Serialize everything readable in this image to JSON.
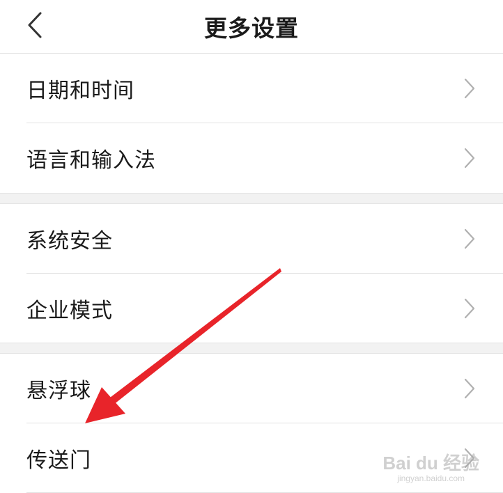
{
  "header": {
    "back_icon": "chevron-left-icon",
    "title": "更多设置"
  },
  "groups": [
    {
      "items": [
        {
          "label": "日期和时间"
        },
        {
          "label": "语言和输入法"
        }
      ]
    },
    {
      "items": [
        {
          "label": "系统安全"
        },
        {
          "label": "企业模式"
        }
      ]
    },
    {
      "items": [
        {
          "label": "悬浮球"
        },
        {
          "label": "传送门"
        }
      ]
    }
  ],
  "row_chevron_icon": "chevron-right-icon",
  "annotation": {
    "arrow_color": "#e8242a",
    "points_to": "悬浮球"
  },
  "watermark": {
    "main_text": "Bai du 经验",
    "sub_text": "jingyan.baidu.com"
  }
}
